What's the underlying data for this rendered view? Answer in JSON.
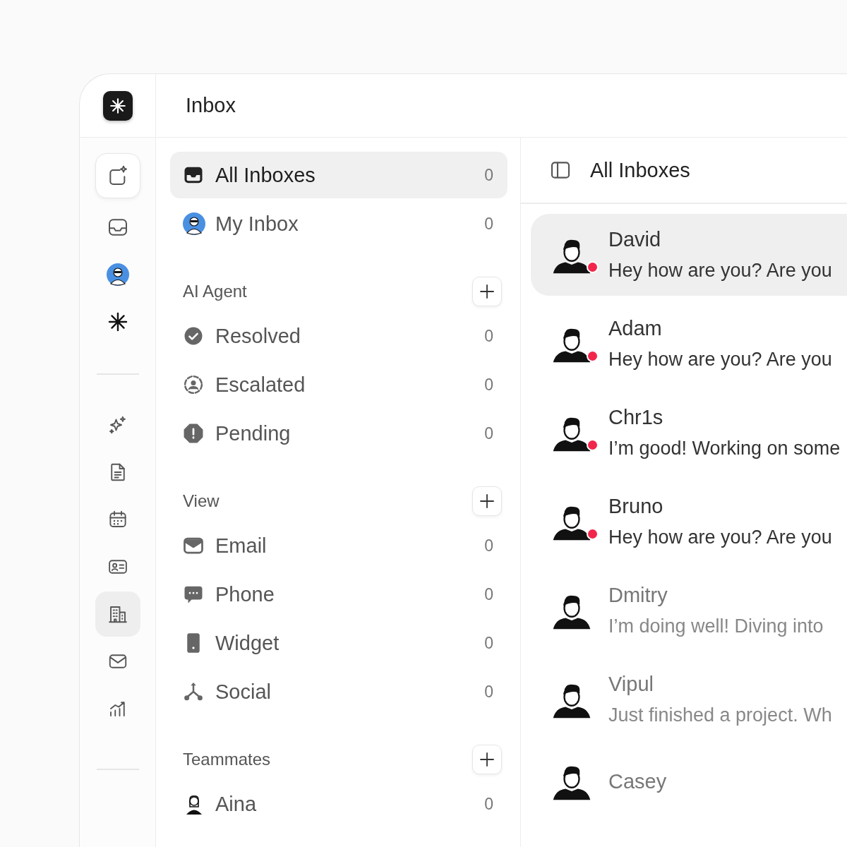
{
  "app": {
    "title": "Inbox"
  },
  "rail": {
    "top": [
      {
        "selected": false
      },
      {
        "selected": false
      },
      {
        "selected": false
      }
    ],
    "tools": [
      {
        "selected": false
      },
      {
        "selected": false
      },
      {
        "selected": false
      },
      {
        "selected": false
      },
      {
        "selected": true
      },
      {
        "selected": false
      },
      {
        "selected": false
      }
    ]
  },
  "sidebar": {
    "items": [
      {
        "label": "All Inboxes",
        "count": "0",
        "selected": true
      },
      {
        "label": "My Inbox",
        "count": "0",
        "selected": false
      }
    ],
    "sections": [
      {
        "title": "AI Agent",
        "items": [
          {
            "label": "Resolved",
            "count": "0",
            "selected": false
          },
          {
            "label": "Escalated",
            "count": "0",
            "selected": false
          },
          {
            "label": "Pending",
            "count": "0",
            "selected": false
          }
        ]
      },
      {
        "title": "View",
        "items": [
          {
            "label": "Email",
            "count": "0",
            "selected": false
          },
          {
            "label": "Phone",
            "count": "0",
            "selected": false
          },
          {
            "label": "Widget",
            "count": "0",
            "selected": false
          },
          {
            "label": "Social",
            "count": "0",
            "selected": false
          }
        ]
      },
      {
        "title": "Teammates",
        "items": [
          {
            "label": "Aina",
            "count": "0",
            "selected": false
          }
        ]
      }
    ]
  },
  "conversations": {
    "title": "All Inboxes",
    "items": [
      {
        "name": "David",
        "preview": "Hey how are you? Are you",
        "unread": true,
        "selected": true
      },
      {
        "name": "Adam",
        "preview": "Hey how are you? Are you",
        "unread": true,
        "selected": false
      },
      {
        "name": "Chr1s",
        "preview": "I’m good! Working on some",
        "unread": true,
        "selected": false
      },
      {
        "name": "Bruno",
        "preview": "Hey how are you? Are you",
        "unread": true,
        "selected": false
      },
      {
        "name": "Dmitry",
        "preview": "I’m doing well! Diving into",
        "unread": false,
        "selected": false
      },
      {
        "name": "Vipul",
        "preview": "Just finished a project. Wh",
        "unread": false,
        "selected": false
      },
      {
        "name": "Casey",
        "unread": false,
        "selected": false
      }
    ]
  }
}
